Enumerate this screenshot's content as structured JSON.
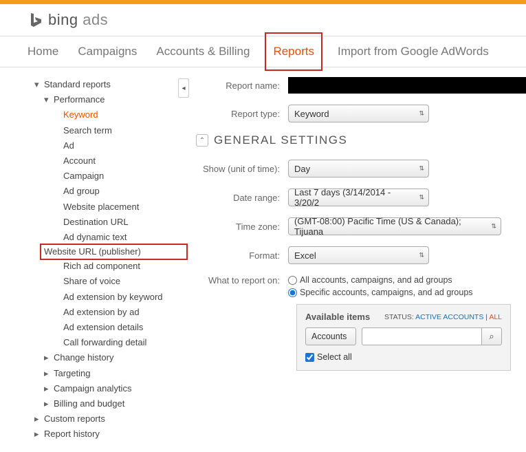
{
  "brand": {
    "name": "bing",
    "suffix": " ads"
  },
  "nav": {
    "home": "Home",
    "campaigns": "Campaigns",
    "accounts": "Accounts & Billing",
    "reports": "Reports",
    "import": "Import from Google AdWords"
  },
  "sidebar": {
    "standard": "Standard reports",
    "performance": "Performance",
    "items": [
      "Keyword",
      "Search term",
      "Ad",
      "Account",
      "Campaign",
      "Ad group",
      "Website placement",
      "Destination URL",
      "Ad dynamic text",
      "Website URL (publisher)",
      "Rich ad component",
      "Share of voice",
      "Ad extension by keyword",
      "Ad extension by ad",
      "Ad extension details",
      "Call forwarding detail"
    ],
    "change_history": "Change history",
    "targeting": "Targeting",
    "campaign_analytics": "Campaign analytics",
    "billing_budget": "Billing and budget",
    "custom": "Custom reports",
    "history": "Report history"
  },
  "form": {
    "report_name_lbl": "Report name:",
    "report_type_lbl": "Report type:",
    "report_type_val": "Keyword",
    "general_settings": "General Settings",
    "show_lbl": "Show (unit of time):",
    "show_val": "Day",
    "date_lbl": "Date range:",
    "date_val": "Last 7 days (3/14/2014 - 3/20/2",
    "tz_lbl": "Time zone:",
    "tz_val": "(GMT-08:00) Pacific Time (US & Canada); Tijuana",
    "format_lbl": "Format:",
    "format_val": "Excel",
    "what_lbl": "What to report on:",
    "radio_all": "All accounts, campaigns, and ad groups",
    "radio_specific": "Specific accounts, campaigns, and ad groups"
  },
  "available": {
    "title": "Available items",
    "status_lbl": "STATUS: ",
    "status_active": "ACTIVE ACCOUNTS",
    "status_sep": " | ",
    "status_all": "ALL",
    "selector": "Accounts",
    "select_all": "Select all"
  }
}
